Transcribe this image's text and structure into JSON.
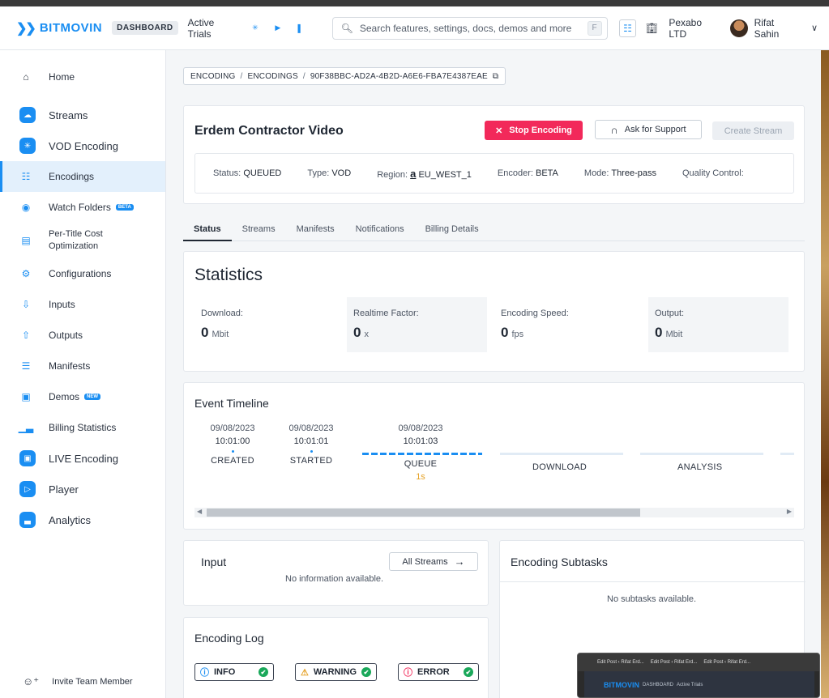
{
  "brand": {
    "name": "BITMOVIN",
    "pill": "DASHBOARD",
    "color": "#1a8ef2"
  },
  "topbar": {
    "active_trials": "Active Trials",
    "search_placeholder": "Search features, settings, docs, demos and more",
    "search_shortcut": "F",
    "org": "Pexabo LTD",
    "user": "Rifat Sahin"
  },
  "sidebar": {
    "items": [
      {
        "label": "Home",
        "icon": "home-icon"
      },
      {
        "label": "Streams",
        "icon": "streams-icon"
      },
      {
        "label": "VOD Encoding",
        "icon": "vod-encoding-icon"
      },
      {
        "label": "Encodings",
        "icon": "encodings-icon"
      },
      {
        "label": "Watch Folders",
        "icon": "watch-folders-icon",
        "badge": "BETA"
      },
      {
        "label": "Per-Title Cost",
        "label2": "Optimization",
        "icon": "per-title-icon"
      },
      {
        "label": "Configurations",
        "icon": "configurations-icon"
      },
      {
        "label": "Inputs",
        "icon": "inputs-icon"
      },
      {
        "label": "Outputs",
        "icon": "outputs-icon"
      },
      {
        "label": "Manifests",
        "icon": "manifests-icon"
      },
      {
        "label": "Demos",
        "icon": "demos-icon",
        "badge": "NEW"
      },
      {
        "label": "Billing Statistics",
        "icon": "billing-icon"
      },
      {
        "label": "LIVE Encoding",
        "icon": "live-encoding-icon"
      },
      {
        "label": "Player",
        "icon": "player-icon"
      },
      {
        "label": "Analytics",
        "icon": "analytics-icon"
      }
    ],
    "invite": "Invite Team Member"
  },
  "breadcrumb": {
    "a": "ENCODING",
    "b": "ENCODINGS",
    "c": "90F38BBC-AD2A-4B2D-A6E6-FBA7E4387EAE",
    "sep": "/"
  },
  "encoding": {
    "title": "Erdem Contractor Video",
    "stop_label": "Stop Encoding",
    "support_label": "Ask for Support",
    "create_label": "Create Stream",
    "status_label": "Status:",
    "status": "QUEUED",
    "type_label": "Type:",
    "type": "VOD",
    "region_label": "Region:",
    "region_prefix": "a",
    "region": "EU_WEST_1",
    "encoder_label": "Encoder:",
    "encoder": "BETA",
    "mode_label": "Mode:",
    "mode": "Three-pass",
    "qc_label": "Quality Control:"
  },
  "tabs": [
    "Status",
    "Streams",
    "Manifests",
    "Notifications",
    "Billing Details"
  ],
  "statistics": {
    "title": "Statistics",
    "items": [
      {
        "label": "Download:",
        "value": "0",
        "unit": "Mbit"
      },
      {
        "label": "Realtime Factor:",
        "value": "0",
        "unit": "x"
      },
      {
        "label": "Encoding Speed:",
        "value": "0",
        "unit": "fps"
      },
      {
        "label": "Output:",
        "value": "0",
        "unit": "Mbit"
      }
    ]
  },
  "timeline": {
    "title": "Event Timeline",
    "events": [
      {
        "date": "09/08/2023",
        "time": "10:01:00",
        "label": "CREATED"
      },
      {
        "date": "09/08/2023",
        "time": "10:01:01",
        "label": "STARTED"
      },
      {
        "date": "09/08/2023",
        "time": "10:01:03",
        "label": "QUEUE",
        "duration": "1s"
      }
    ],
    "stages": [
      "DOWNLOAD",
      "ANALYSIS"
    ]
  },
  "input": {
    "title": "Input",
    "all_streams": "All Streams",
    "empty": "No information available."
  },
  "subtasks": {
    "title": "Encoding Subtasks",
    "empty": "No subtasks available."
  },
  "log": {
    "title": "Encoding Log",
    "levels": [
      "INFO",
      "WARNING",
      "ERROR"
    ]
  },
  "taskbar_preview": {
    "tabs": [
      "Edit Post ‹ Rifat Erd...",
      "Edit Post ‹ Rifat Erd...",
      "Edit Post ‹ Rifat Erd..."
    ],
    "brand": "BITMOVIN",
    "pill": "DASHBOARD",
    "trials": "Active Trials"
  }
}
